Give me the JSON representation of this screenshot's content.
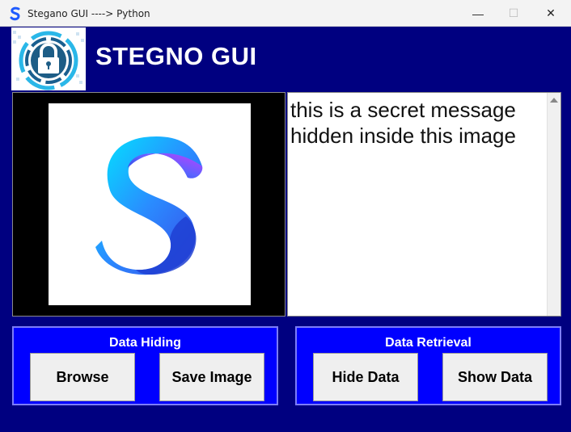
{
  "window": {
    "title": "Stegano GUI ----> Python",
    "minimize_glyph": "—",
    "maximize_glyph": "☐",
    "close_glyph": "✕"
  },
  "header": {
    "title": "STEGNO GUI",
    "logo_icon": "padlock-icon"
  },
  "message": {
    "text": "this is a secret message\nhidden inside this image"
  },
  "data_hiding": {
    "title": "Data Hiding",
    "browse_label": "Browse",
    "save_label": "Save Image"
  },
  "data_retrieval": {
    "title": "Data Retrieval",
    "hide_label": "Hide Data",
    "show_label": "Show Data"
  },
  "colors": {
    "background": "#000080",
    "panel": "#0000ff",
    "accent": "#00e5ff"
  }
}
